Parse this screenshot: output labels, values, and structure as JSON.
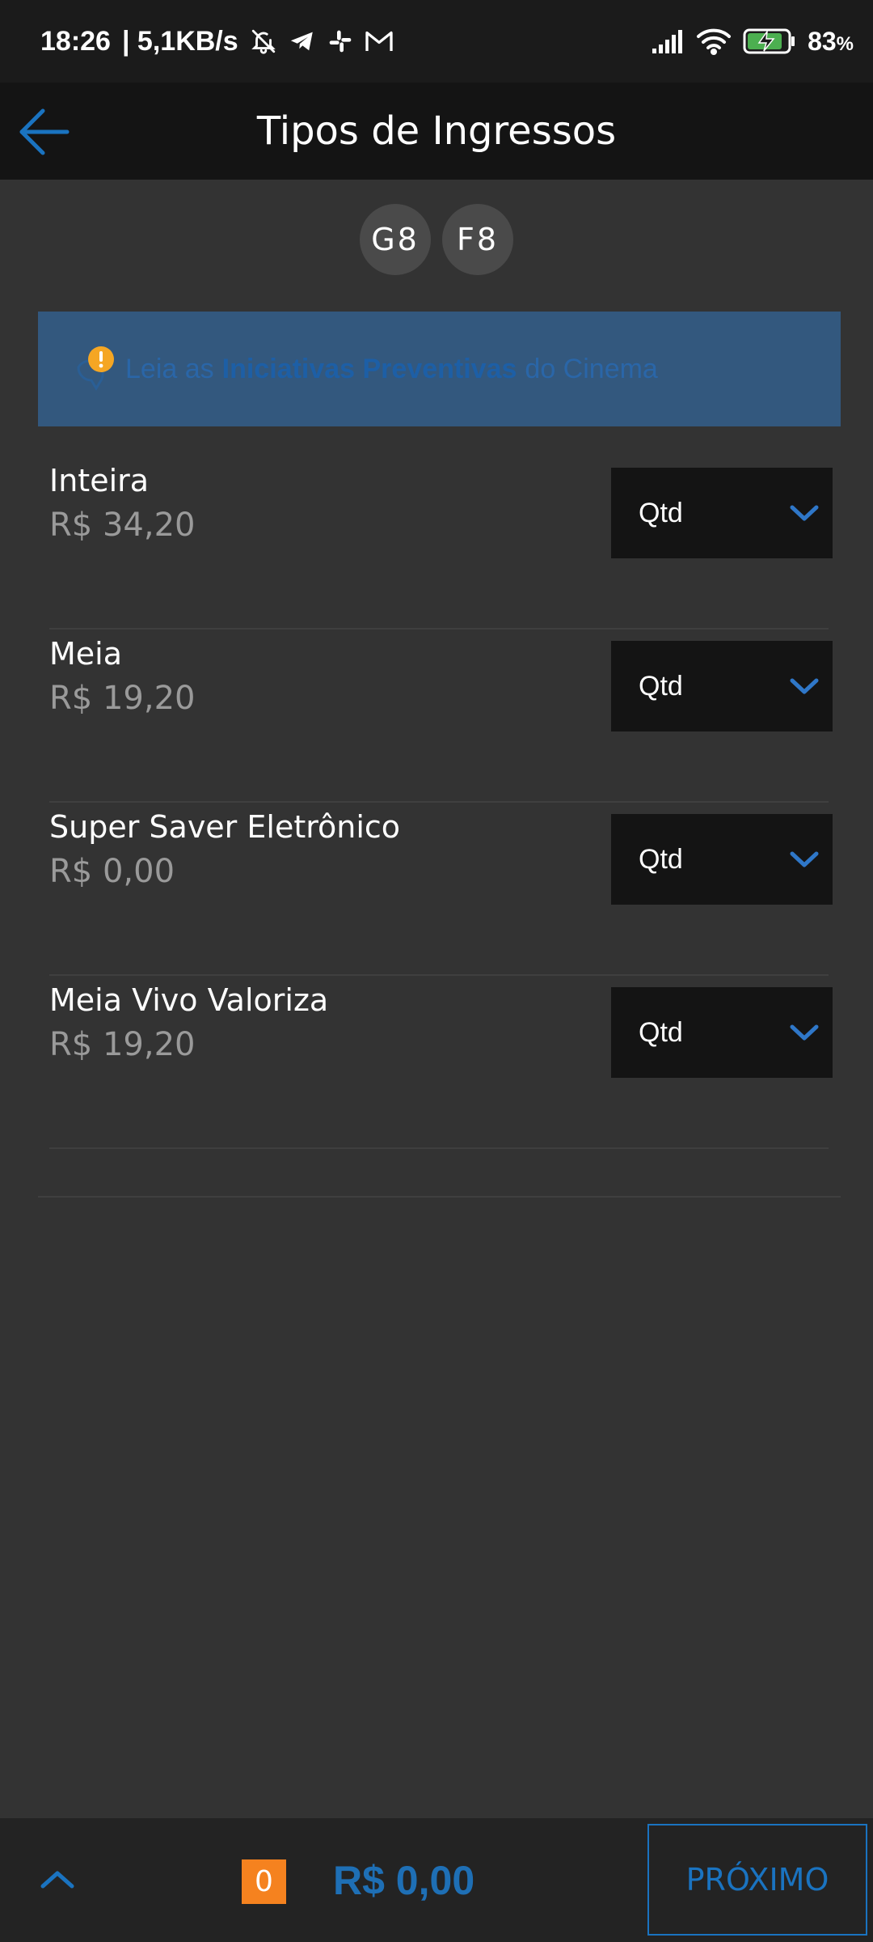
{
  "status_bar": {
    "time": "18:26",
    "network_speed": "| 5,1KB/s",
    "battery_percent": "83",
    "battery_suffix": "%",
    "icons": [
      "bell-off-icon",
      "telegram-icon",
      "slack-icon",
      "gmail-icon",
      "signal-icon",
      "wifi-icon",
      "battery-charging-icon"
    ]
  },
  "header": {
    "title": "Tipos de Ingressos"
  },
  "seats": [
    "G8",
    "F8"
  ],
  "notice": {
    "prefix": "Leia as",
    "strong": "Iniciativas Preventivas",
    "suffix": "do Cinema"
  },
  "tickets": [
    {
      "name": "Inteira",
      "price": "R$ 34,20",
      "qty_label": "Qtd"
    },
    {
      "name": "Meia",
      "price": "R$ 19,20",
      "qty_label": "Qtd"
    },
    {
      "name": "Super Saver Eletrônico",
      "price": "R$ 0,00",
      "qty_label": "Qtd"
    },
    {
      "name": "Meia Vivo Valoriza",
      "price": "R$ 19,20",
      "qty_label": "Qtd"
    }
  ],
  "footer": {
    "count": "0",
    "total": "R$ 0,00",
    "next_label": "PRÓXIMO"
  },
  "colors": {
    "accent_blue": "#1a73c0",
    "badge_orange": "#f5821f",
    "notice_bg": "#33587e",
    "warning_orange": "#f5a623",
    "battery_green": "#4caf50"
  }
}
